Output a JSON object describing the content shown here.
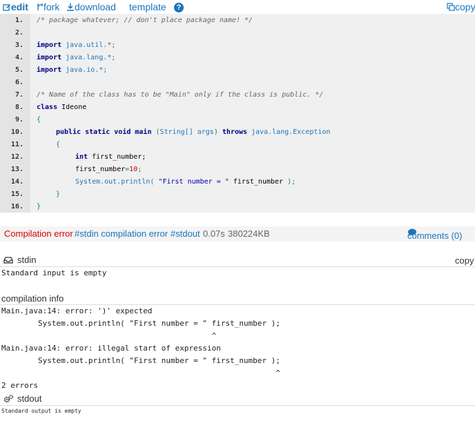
{
  "toolbar": {
    "edit_label": "edit",
    "fork_label": "fork",
    "download_label": "download",
    "template_label": "template",
    "help_label": "?",
    "copy_label": "copy"
  },
  "code": {
    "line_numbers": [
      "1.",
      "2.",
      "3.",
      "4.",
      "5.",
      "6.",
      "7.",
      "8.",
      "9.",
      "10.",
      "11.",
      "12.",
      "13.",
      "14.",
      "15.",
      "16."
    ],
    "l1": "/* package whatever; // don't place package name! */",
    "l3_kw": "import",
    "l3_pkg": "java.util.*;",
    "l4_kw": "import",
    "l4_pkg": "java.lang.*;",
    "l5_kw": "import",
    "l5_pkg": "java.io.*;",
    "l7": "/* Name of the class has to be \"Main\" only if the class is public. */",
    "l8_kw": "class",
    "l8_name": "Ideone",
    "l9": "{",
    "l10_kw": "public static void main",
    "l10_open": "(",
    "l10_type": "String[]",
    "l10_arg": "args",
    "l10_close": ")",
    "l10_throws": "throws",
    "l10_exc": "java.lang.Exception",
    "l11": "{",
    "l12_kw": "int",
    "l12_var": "first_number;",
    "l13_var": "first_number",
    "l13_eq": "=",
    "l13_num": "10",
    "l13_end": ";",
    "l14_call": "System.out.println(",
    "l14_str": "\"First number = \"",
    "l14_var": "first_number",
    "l14_end": ");",
    "l15": "}",
    "l16": "}"
  },
  "status": {
    "result": "Compilation error",
    "stdin_link": "#stdin compilation error",
    "stdout_link": "#stdout",
    "time": "0.07s",
    "memory": "380224KB",
    "comments": "comments (0)"
  },
  "stdin": {
    "title": "stdin",
    "copy": "copy",
    "content": "Standard input is empty"
  },
  "compilation": {
    "title": "compilation info",
    "lines": [
      "Main.java:14: error: ')' expected",
      "        System.out.println( \"First number = \" first_number );",
      "                                              ^",
      "Main.java:14: error: illegal start of expression",
      "        System.out.println( \"First number = \" first_number );",
      "                                                            ^",
      "2 errors"
    ]
  },
  "stdout": {
    "title": "stdout",
    "content": "Standard output is empty"
  },
  "colors": {
    "accent": "#1a75bb",
    "error": "#dd0000"
  }
}
